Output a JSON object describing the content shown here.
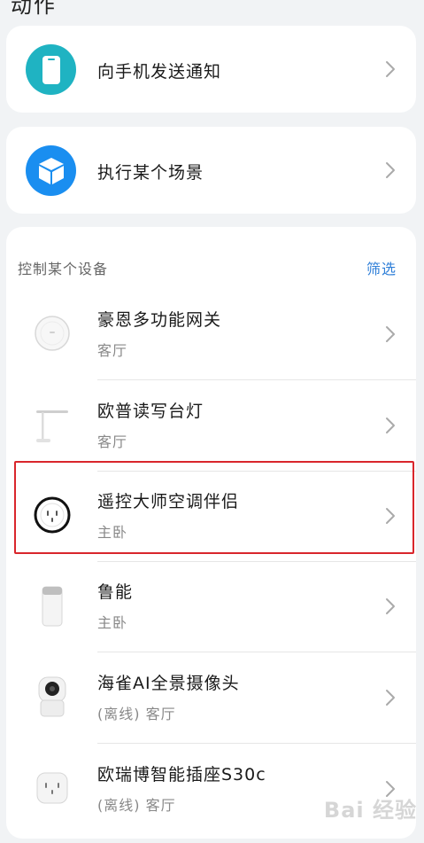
{
  "header": {
    "title_cut": "动作"
  },
  "actions": [
    {
      "label": "向手机发送通知",
      "icon": "phone-icon",
      "color": "#1fb3c2"
    },
    {
      "label": "执行某个场景",
      "icon": "cube-icon",
      "color": "#1a8ef0"
    }
  ],
  "devices_section": {
    "title": "控制某个设备",
    "filter_label": "筛选",
    "items": [
      {
        "name": "豪恩多功能网关",
        "room": "客厅",
        "icon": "gateway-icon"
      },
      {
        "name": "欧普读写台灯",
        "room": "客厅",
        "icon": "desk-lamp-icon"
      },
      {
        "name": "遥控大师空调伴侣",
        "room": "主卧",
        "icon": "ac-companion-plug-icon",
        "highlighted": true
      },
      {
        "name": "鲁能",
        "room": "主卧",
        "icon": "air-purifier-icon"
      },
      {
        "name": "海雀AI全景摄像头",
        "room": "(离线) 客厅",
        "icon": "camera-icon"
      },
      {
        "name": "欧瑞博智能插座S30c",
        "room": "(离线) 客厅",
        "icon": "smart-socket-icon"
      }
    ]
  },
  "watermark": "Bai 经验"
}
